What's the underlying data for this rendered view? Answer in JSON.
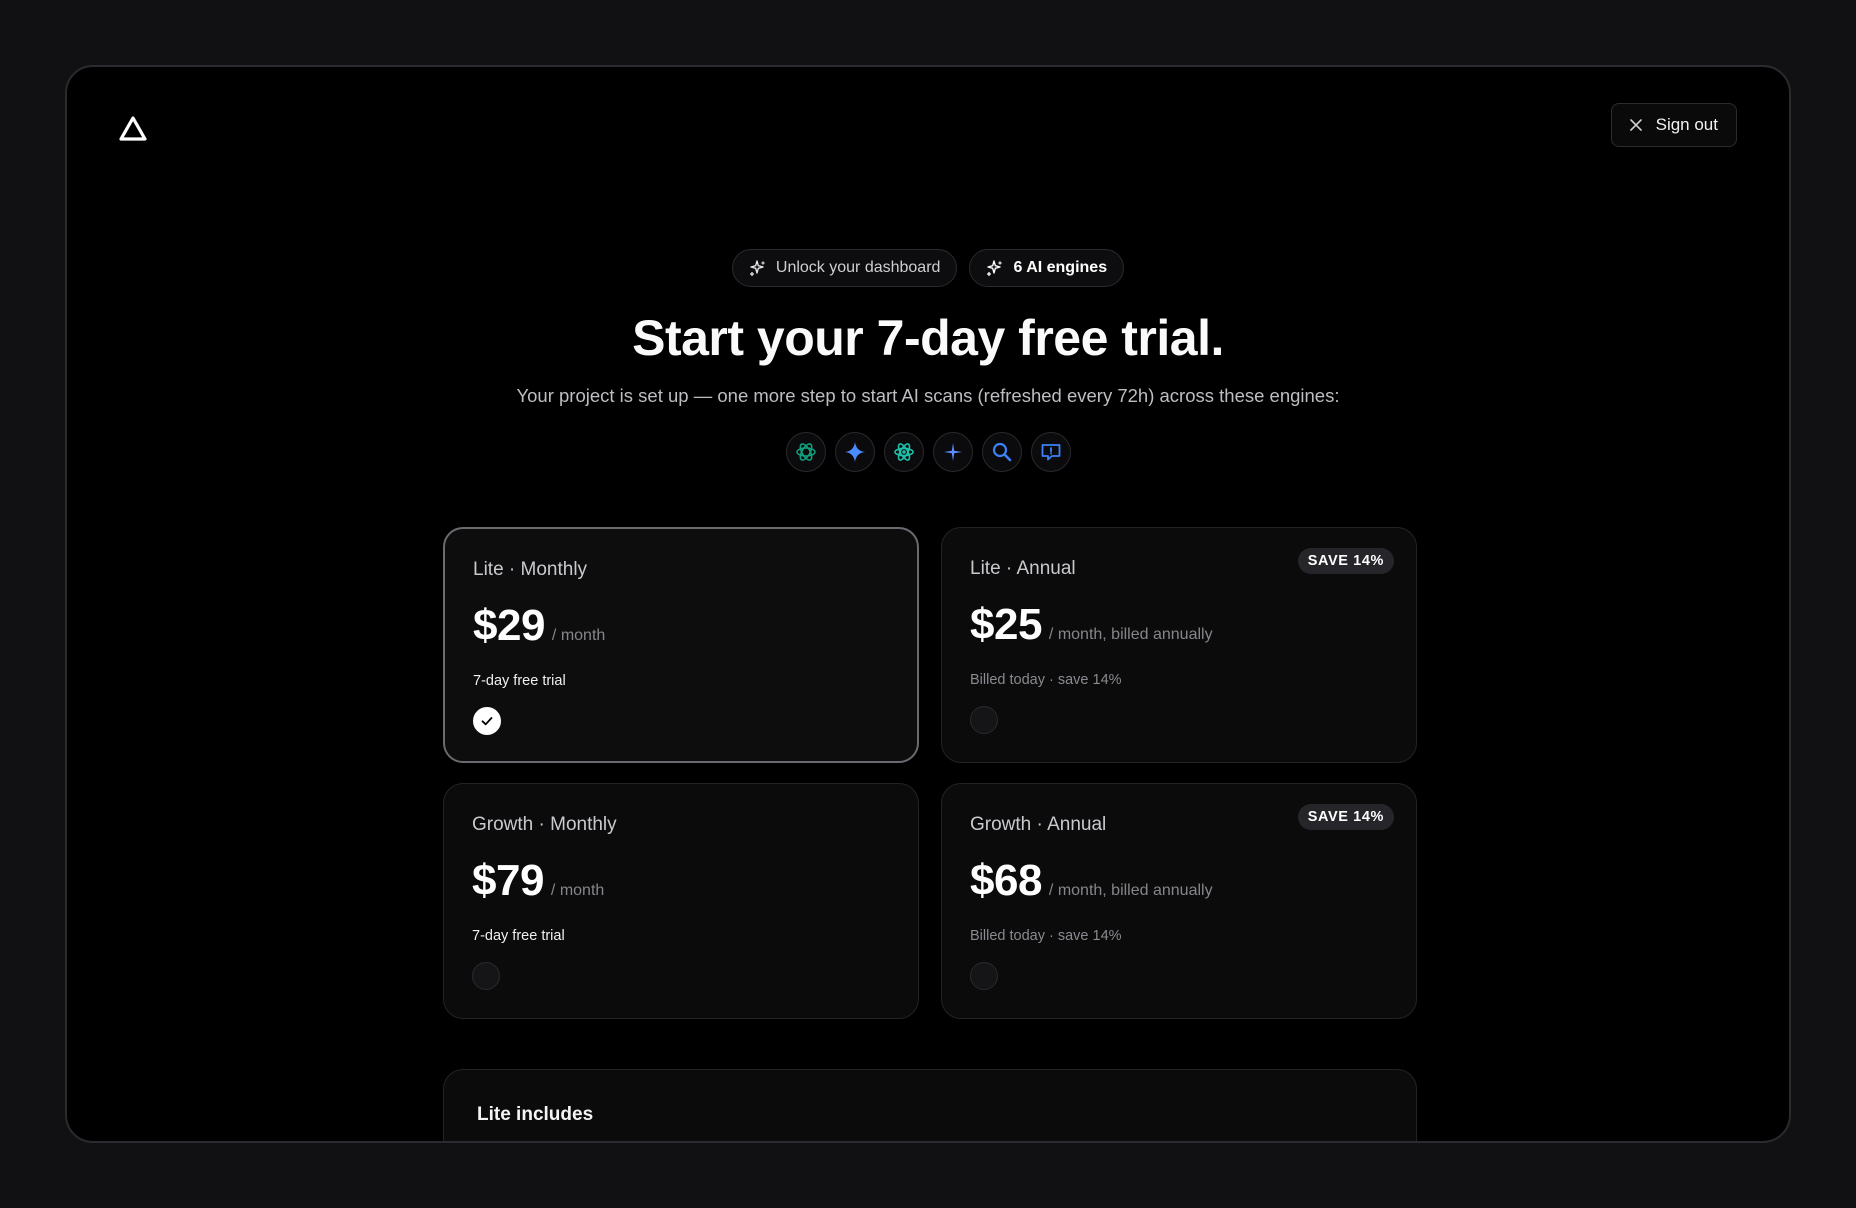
{
  "header": {
    "sign_out_label": "Sign out"
  },
  "badges": {
    "unlock": "Unlock your dashboard",
    "engines": "6 AI engines"
  },
  "hero": {
    "title": "Start your 7-day free trial.",
    "subtitle": "Your project is set up — one more step to start AI scans (refreshed every 72h) across these engines:"
  },
  "engines": [
    {
      "icon": "chatgpt-icon",
      "color": "#10a37f"
    },
    {
      "icon": "gemini-icon",
      "color": "#4a8cff"
    },
    {
      "icon": "atom-icon",
      "color": "#20c0a8"
    },
    {
      "icon": "sparkle-icon",
      "color": "#5b8dff"
    },
    {
      "icon": "search-icon",
      "color": "#3b82f6"
    },
    {
      "icon": "chat-icon",
      "color": "#3b82f6"
    }
  ],
  "plans": [
    {
      "name": "Lite · Monthly",
      "price": "$29",
      "period": "/ month",
      "note": "7-day free trial",
      "selected": true
    },
    {
      "name": "Lite · Annual",
      "price": "$25",
      "period": "/ month, billed annually",
      "note": "Billed today · save 14%",
      "badge": "SAVE 14%",
      "selected": false
    },
    {
      "name": "Growth · Monthly",
      "price": "$79",
      "period": "/ month",
      "note": "7-day free trial",
      "selected": false
    },
    {
      "name": "Growth · Annual",
      "price": "$68",
      "period": "/ month, billed annually",
      "note": "Billed today · save 14%",
      "badge": "SAVE 14%",
      "selected": false
    }
  ],
  "includes": {
    "title": "Lite includes"
  }
}
